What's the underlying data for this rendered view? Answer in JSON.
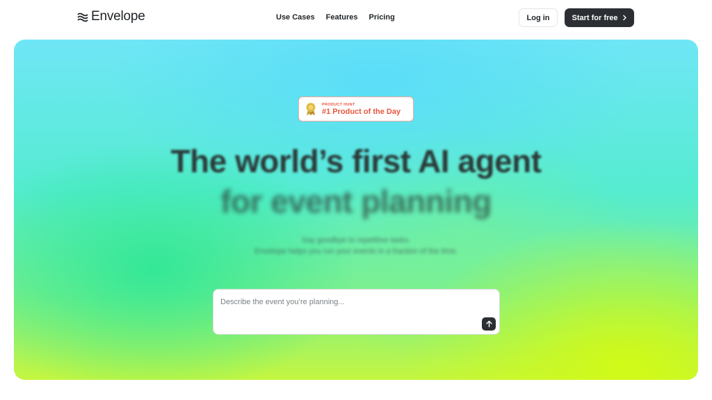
{
  "brand": {
    "name": "Envelope",
    "logo_icon": "waves-icon"
  },
  "nav": {
    "links": [
      {
        "label": "Use Cases"
      },
      {
        "label": "Features"
      },
      {
        "label": "Pricing"
      }
    ],
    "login_label": "Log in",
    "start_label": "Start for free"
  },
  "hero": {
    "badge": {
      "small": "PRODUCT HUNT",
      "big": "#1 Product of the Day",
      "icon": "medal-icon",
      "color": "#e8553f"
    },
    "headline_line1": "The world’s first AI agent",
    "headline_line2": "for event planning",
    "sub_line1": "Say goodbye to repetitive tasks.",
    "sub_line2": "Envelope helps you run your events in a fraction of the time.",
    "prompt_placeholder": "Describe the event you’re planning...",
    "send_icon": "arrow-up-icon"
  },
  "colors": {
    "primary_button": "#2b2e33",
    "accent": "#e8553f"
  }
}
